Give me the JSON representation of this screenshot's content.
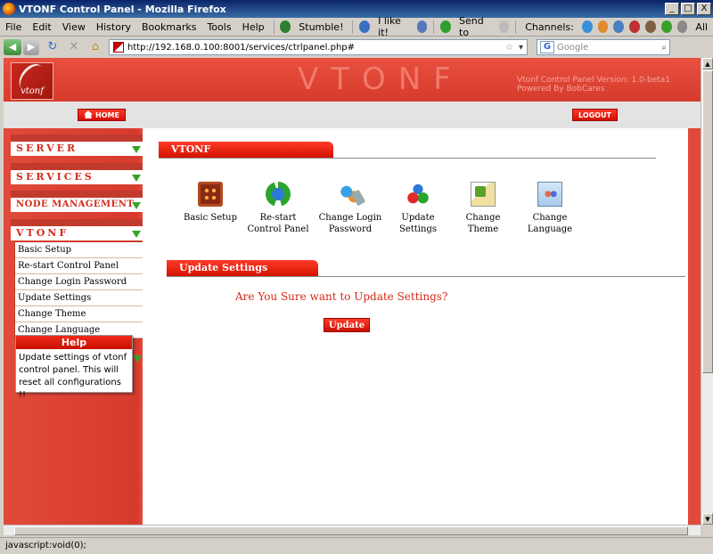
{
  "window": {
    "title": "VTONF Control Panel - Mozilla Firefox",
    "min": "_",
    "max": "□",
    "close": "X"
  },
  "menu": {
    "items": [
      "File",
      "Edit",
      "View",
      "History",
      "Bookmarks",
      "Tools",
      "Help"
    ],
    "stumble": "Stumble!",
    "ilike": "I like it!",
    "sendto": "Send to",
    "channels": "Channels:",
    "all": "All"
  },
  "nav": {
    "url": "http://192.168.0.100:8001/services/ctrlpanel.php#",
    "search_placeholder": "Google"
  },
  "header": {
    "logo_text": "vtonf",
    "brand": "VTONF",
    "version_line1": "Vtonf Control Panel Version: 1.0-beta1",
    "version_line2": "Powered By BobCares"
  },
  "topbar": {
    "home": "HOME",
    "logout": "LOGOUT"
  },
  "sidebar": {
    "sections": [
      "SERVER",
      "SERVICES",
      "NODE MANAGEMENT",
      "VTONF"
    ],
    "vtonf_items": [
      "Basic Setup",
      "Re-start Control Panel",
      "Change Login Password",
      "Update Settings",
      "Change Theme",
      "Change Language"
    ]
  },
  "help": {
    "title": "Help",
    "body": "Update settings of vtonf control panel. This will reset all configurations !!"
  },
  "content": {
    "section_title": "VTONF",
    "tiles": [
      {
        "line1": "Basic Setup",
        "line2": ""
      },
      {
        "line1": "Re-start",
        "line2": "Control Panel"
      },
      {
        "line1": "Change Login",
        "line2": "Password"
      },
      {
        "line1": "Update",
        "line2": "Settings"
      },
      {
        "line1": "Change",
        "line2": "Theme"
      },
      {
        "line1": "Change",
        "line2": "Language"
      }
    ],
    "update_title": "Update Settings",
    "question": "Are You Sure want to Update Settings?",
    "update_button": "Update"
  },
  "status": {
    "text": "javascript:void(0);"
  }
}
